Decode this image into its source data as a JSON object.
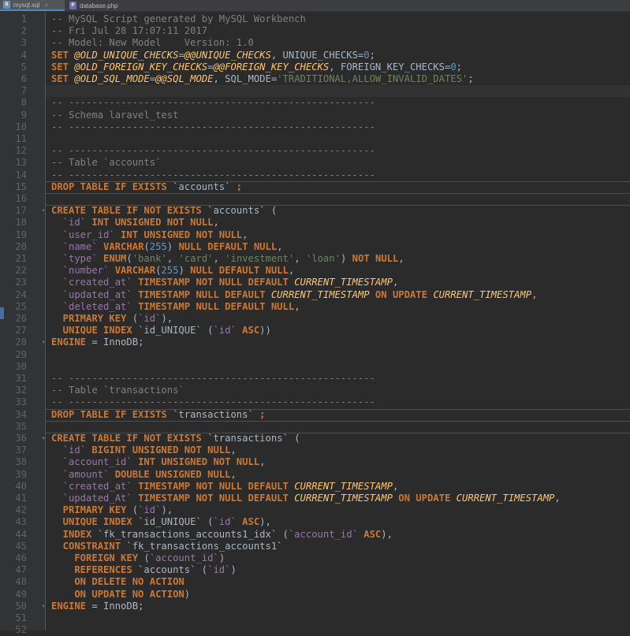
{
  "tabs": [
    {
      "label": "mysql.sql",
      "icon": "sql-file-icon",
      "active": true
    },
    {
      "label": "database.php",
      "icon": "php-file-icon",
      "active": false
    }
  ],
  "lines": [
    {
      "n": "1",
      "tokens": [
        {
          "t": "-- MySQL Script generated by MySQL Workbench",
          "c": "c"
        }
      ]
    },
    {
      "n": "2",
      "tokens": [
        {
          "t": "-- Fri Jul 28 17:07:11 2017",
          "c": "c"
        }
      ]
    },
    {
      "n": "3",
      "tokens": [
        {
          "t": "-- Model: New Model    Version: 1.0",
          "c": "c"
        }
      ]
    },
    {
      "n": "4",
      "tokens": [
        {
          "t": "SET ",
          "c": "k"
        },
        {
          "t": "@OLD_UNIQUE_CHECKS",
          "c": "f"
        },
        {
          "t": "=",
          "c": "v"
        },
        {
          "t": "@@UNIQUE_CHECKS",
          "c": "f"
        },
        {
          "t": ", UNIQUE_CHECKS=",
          "c": "v"
        },
        {
          "t": "0",
          "c": "n"
        },
        {
          "t": ";",
          "c": "v"
        }
      ]
    },
    {
      "n": "5",
      "tokens": [
        {
          "t": "SET ",
          "c": "k"
        },
        {
          "t": "@OLD_FOREIGN_KEY_CHECKS",
          "c": "f"
        },
        {
          "t": "=",
          "c": "v"
        },
        {
          "t": "@@FOREIGN_KEY_CHECKS",
          "c": "f"
        },
        {
          "t": ", FOREIGN_KEY_CHECKS=",
          "c": "v"
        },
        {
          "t": "0",
          "c": "n"
        },
        {
          "t": ";",
          "c": "v"
        }
      ]
    },
    {
      "n": "6",
      "tokens": [
        {
          "t": "SET ",
          "c": "k"
        },
        {
          "t": "@OLD_SQL_MODE",
          "c": "f"
        },
        {
          "t": "=",
          "c": "v"
        },
        {
          "t": "@@SQL_MODE",
          "c": "f"
        },
        {
          "t": ", SQL_MODE=",
          "c": "v"
        },
        {
          "t": "'TRADITIONAL,ALLOW_INVALID_DATES'",
          "c": "s"
        },
        {
          "t": ";",
          "c": "v"
        }
      ]
    },
    {
      "n": "7",
      "tokens": []
    },
    {
      "n": "8",
      "tokens": [
        {
          "t": "-- -----------------------------------------------------",
          "c": "c"
        }
      ]
    },
    {
      "n": "9",
      "tokens": [
        {
          "t": "-- Schema laravel_test",
          "c": "c"
        }
      ]
    },
    {
      "n": "10",
      "tokens": [
        {
          "t": "-- -----------------------------------------------------",
          "c": "c"
        }
      ]
    },
    {
      "n": "11",
      "tokens": []
    },
    {
      "n": "12",
      "tokens": [
        {
          "t": "-- -----------------------------------------------------",
          "c": "c"
        }
      ]
    },
    {
      "n": "13",
      "tokens": [
        {
          "t": "-- Table `accounts`",
          "c": "c"
        }
      ]
    },
    {
      "n": "14",
      "tokens": [
        {
          "t": "-- -----------------------------------------------------",
          "c": "c"
        }
      ]
    },
    {
      "n": "15",
      "tokens": [
        {
          "t": "DROP TABLE IF EXISTS ",
          "c": "k"
        },
        {
          "t": "`accounts`",
          "c": "q"
        },
        {
          "t": " ;",
          "c": "k"
        }
      ]
    },
    {
      "n": "16",
      "tokens": []
    },
    {
      "n": "17",
      "tokens": [
        {
          "t": "CREATE TABLE IF NOT EXISTS ",
          "c": "k"
        },
        {
          "t": "`accounts`",
          "c": "q"
        },
        {
          "t": " (",
          "c": "v"
        }
      ]
    },
    {
      "n": "18",
      "tokens": [
        {
          "t": "  `id`",
          "c": "id"
        },
        {
          "t": " INT UNSIGNED NOT NULL",
          "c": "k"
        },
        {
          "t": ",",
          "c": "v"
        }
      ]
    },
    {
      "n": "19",
      "tokens": [
        {
          "t": "  `user_id`",
          "c": "id"
        },
        {
          "t": " INT UNSIGNED NOT NULL",
          "c": "k"
        },
        {
          "t": ",",
          "c": "v"
        }
      ]
    },
    {
      "n": "20",
      "tokens": [
        {
          "t": "  `name`",
          "c": "id"
        },
        {
          "t": " VARCHAR",
          "c": "k"
        },
        {
          "t": "(",
          "c": "v"
        },
        {
          "t": "255",
          "c": "n"
        },
        {
          "t": ") ",
          "c": "v"
        },
        {
          "t": "NULL DEFAULT NULL",
          "c": "k"
        },
        {
          "t": ",",
          "c": "v"
        }
      ]
    },
    {
      "n": "21",
      "tokens": [
        {
          "t": "  `type`",
          "c": "id"
        },
        {
          "t": " ENUM",
          "c": "k"
        },
        {
          "t": "(",
          "c": "v"
        },
        {
          "t": "'bank'",
          "c": "s"
        },
        {
          "t": ", ",
          "c": "v"
        },
        {
          "t": "'card'",
          "c": "s"
        },
        {
          "t": ", ",
          "c": "v"
        },
        {
          "t": "'investment'",
          "c": "s"
        },
        {
          "t": ", ",
          "c": "v"
        },
        {
          "t": "'loan'",
          "c": "s"
        },
        {
          "t": ") ",
          "c": "v"
        },
        {
          "t": "NOT NULL",
          "c": "k"
        },
        {
          "t": ",",
          "c": "v"
        }
      ]
    },
    {
      "n": "22",
      "tokens": [
        {
          "t": "  `number`",
          "c": "id"
        },
        {
          "t": " VARCHAR",
          "c": "k"
        },
        {
          "t": "(",
          "c": "v"
        },
        {
          "t": "255",
          "c": "n"
        },
        {
          "t": ") ",
          "c": "v"
        },
        {
          "t": "NULL DEFAULT NULL",
          "c": "k"
        },
        {
          "t": ",",
          "c": "v"
        }
      ]
    },
    {
      "n": "23",
      "tokens": [
        {
          "t": "  `created_at`",
          "c": "id"
        },
        {
          "t": " TIMESTAMP NOT NULL DEFAULT ",
          "c": "k"
        },
        {
          "t": "CURRENT_TIMESTAMP",
          "c": "f"
        },
        {
          "t": ",",
          "c": "v"
        }
      ]
    },
    {
      "n": "24",
      "tokens": [
        {
          "t": "  `updated_at`",
          "c": "id"
        },
        {
          "t": " TIMESTAMP NULL DEFAULT ",
          "c": "k"
        },
        {
          "t": "CURRENT_TIMESTAMP",
          "c": "f"
        },
        {
          "t": " ON UPDATE ",
          "c": "k"
        },
        {
          "t": "CURRENT_TIMESTAMP",
          "c": "f"
        },
        {
          "t": ",",
          "c": "v"
        }
      ]
    },
    {
      "n": "25",
      "tokens": [
        {
          "t": "  `deleted_at`",
          "c": "id"
        },
        {
          "t": " TIMESTAMP NULL DEFAULT NULL",
          "c": "k"
        },
        {
          "t": ",",
          "c": "v"
        }
      ]
    },
    {
      "n": "26",
      "tokens": [
        {
          "t": "  PRIMARY KEY ",
          "c": "k"
        },
        {
          "t": "(",
          "c": "v"
        },
        {
          "t": "`id`",
          "c": "id"
        },
        {
          "t": "),",
          "c": "v"
        }
      ]
    },
    {
      "n": "27",
      "tokens": [
        {
          "t": "  UNIQUE INDEX ",
          "c": "k"
        },
        {
          "t": "`id_UNIQUE` (",
          "c": "v"
        },
        {
          "t": "`id`",
          "c": "id"
        },
        {
          "t": " ASC",
          "c": "k"
        },
        {
          "t": "))",
          "c": "v"
        }
      ]
    },
    {
      "n": "28",
      "tokens": [
        {
          "t": "ENGINE",
          "c": "k"
        },
        {
          "t": " = InnoDB;",
          "c": "v"
        }
      ]
    },
    {
      "n": "29",
      "tokens": []
    },
    {
      "n": "30",
      "tokens": []
    },
    {
      "n": "31",
      "tokens": [
        {
          "t": "-- -----------------------------------------------------",
          "c": "c"
        }
      ]
    },
    {
      "n": "32",
      "tokens": [
        {
          "t": "-- Table `transactions`",
          "c": "c"
        }
      ]
    },
    {
      "n": "33",
      "tokens": [
        {
          "t": "-- -----------------------------------------------------",
          "c": "c"
        }
      ]
    },
    {
      "n": "34",
      "tokens": [
        {
          "t": "DROP TABLE IF EXISTS ",
          "c": "k"
        },
        {
          "t": "`transactions`",
          "c": "q"
        },
        {
          "t": " ;",
          "c": "k"
        }
      ]
    },
    {
      "n": "35",
      "tokens": []
    },
    {
      "n": "36",
      "tokens": [
        {
          "t": "CREATE TABLE IF NOT EXISTS ",
          "c": "k"
        },
        {
          "t": "`transactions`",
          "c": "q"
        },
        {
          "t": " (",
          "c": "v"
        }
      ]
    },
    {
      "n": "37",
      "tokens": [
        {
          "t": "  `id`",
          "c": "id"
        },
        {
          "t": " BIGINT UNSIGNED NOT NULL",
          "c": "k"
        },
        {
          "t": ",",
          "c": "v"
        }
      ]
    },
    {
      "n": "38",
      "tokens": [
        {
          "t": "  `account_id`",
          "c": "id"
        },
        {
          "t": " INT UNSIGNED NOT NULL",
          "c": "k"
        },
        {
          "t": ",",
          "c": "v"
        }
      ]
    },
    {
      "n": "39",
      "tokens": [
        {
          "t": "  `amount`",
          "c": "id"
        },
        {
          "t": " DOUBLE UNSIGNED NULL",
          "c": "k"
        },
        {
          "t": ",",
          "c": "v"
        }
      ]
    },
    {
      "n": "40",
      "tokens": [
        {
          "t": "  `created_at`",
          "c": "id"
        },
        {
          "t": " TIMESTAMP NOT NULL DEFAULT ",
          "c": "k"
        },
        {
          "t": "CURRENT_TIMESTAMP",
          "c": "f"
        },
        {
          "t": ",",
          "c": "v"
        }
      ]
    },
    {
      "n": "41",
      "tokens": [
        {
          "t": "  `updated_At`",
          "c": "id"
        },
        {
          "t": " TIMESTAMP NOT NULL DEFAULT ",
          "c": "k"
        },
        {
          "t": "CURRENT_TIMESTAMP",
          "c": "f"
        },
        {
          "t": " ON UPDATE ",
          "c": "k"
        },
        {
          "t": "CURRENT_TIMESTAMP",
          "c": "f"
        },
        {
          "t": ",",
          "c": "v"
        }
      ]
    },
    {
      "n": "42",
      "tokens": [
        {
          "t": "  PRIMARY KEY ",
          "c": "k"
        },
        {
          "t": "(",
          "c": "v"
        },
        {
          "t": "`id`",
          "c": "id"
        },
        {
          "t": "),",
          "c": "v"
        }
      ]
    },
    {
      "n": "43",
      "tokens": [
        {
          "t": "  UNIQUE INDEX ",
          "c": "k"
        },
        {
          "t": "`id_UNIQUE` (",
          "c": "v"
        },
        {
          "t": "`id`",
          "c": "id"
        },
        {
          "t": " ASC",
          "c": "k"
        },
        {
          "t": "),",
          "c": "v"
        }
      ]
    },
    {
      "n": "44",
      "tokens": [
        {
          "t": "  INDEX ",
          "c": "k"
        },
        {
          "t": "`fk_transactions_accounts1_idx` (",
          "c": "v"
        },
        {
          "t": "`account_id`",
          "c": "id"
        },
        {
          "t": " ASC",
          "c": "k"
        },
        {
          "t": "),",
          "c": "v"
        }
      ]
    },
    {
      "n": "45",
      "tokens": [
        {
          "t": "  CONSTRAINT ",
          "c": "k"
        },
        {
          "t": "`fk_transactions_accounts1`",
          "c": "v"
        }
      ]
    },
    {
      "n": "46",
      "tokens": [
        {
          "t": "    FOREIGN KEY ",
          "c": "k"
        },
        {
          "t": "(",
          "c": "v"
        },
        {
          "t": "`account_id`",
          "c": "id"
        },
        {
          "t": ")",
          "c": "v"
        }
      ]
    },
    {
      "n": "47",
      "tokens": [
        {
          "t": "    REFERENCES ",
          "c": "k"
        },
        {
          "t": "`accounts` (",
          "c": "v"
        },
        {
          "t": "`id`",
          "c": "id"
        },
        {
          "t": ")",
          "c": "v"
        }
      ]
    },
    {
      "n": "48",
      "tokens": [
        {
          "t": "    ON DELETE NO ACTION",
          "c": "k"
        }
      ]
    },
    {
      "n": "49",
      "tokens": [
        {
          "t": "    ON UPDATE NO ACTION",
          "c": "k"
        },
        {
          "t": ")",
          "c": "v"
        }
      ]
    },
    {
      "n": "50",
      "tokens": [
        {
          "t": "ENGINE",
          "c": "k"
        },
        {
          "t": " = InnoDB;",
          "c": "v"
        }
      ]
    },
    {
      "n": "51",
      "tokens": []
    },
    {
      "n": "52",
      "tokens": []
    }
  ],
  "folded_lines": [
    "17",
    "28",
    "36",
    "50"
  ],
  "current_line": "7",
  "colors": {
    "background": "#2b2b2b",
    "gutter": "#313335",
    "keyword": "#cc7832",
    "string": "#6a8759",
    "number": "#6897bb",
    "identifier": "#9876aa",
    "comment": "#808080",
    "function": "#ffc66d",
    "text": "#a9b7c6"
  }
}
